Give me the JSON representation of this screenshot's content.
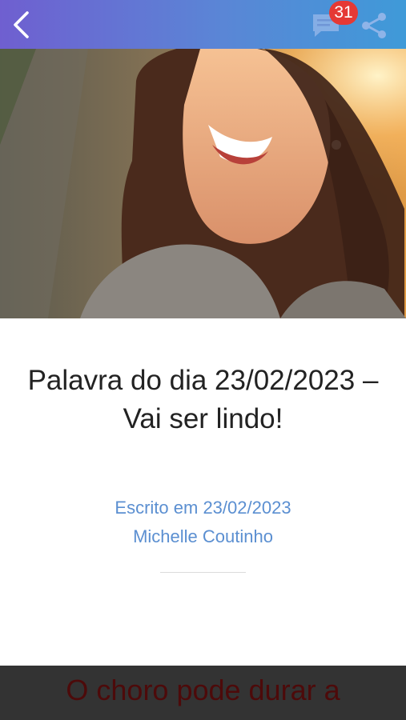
{
  "header": {
    "comment_count": "31",
    "back_icon": "chevron-left-icon",
    "comment_icon": "comment-icon",
    "share_icon": "share-icon",
    "gradient_start": "#6f5fd0",
    "gradient_end": "#3f9ad8",
    "badge_color": "#e53935"
  },
  "article": {
    "title": "Palavra do dia 23/02/2023 – Vai ser lindo!",
    "written_on": "Escrito em 23/02/2023",
    "author": "Michelle Coutinho"
  },
  "footer": {
    "banner_text": "O choro pode durar a"
  },
  "colors": {
    "meta_text": "#5b8fd1",
    "footer_bg": "#333333",
    "footer_text": "#4d0a0a"
  }
}
